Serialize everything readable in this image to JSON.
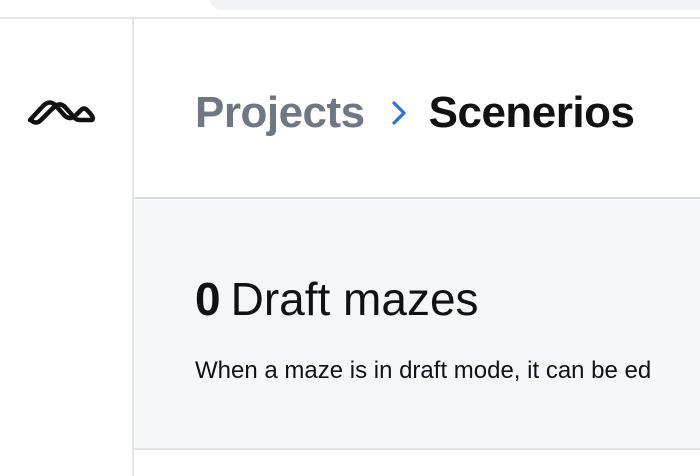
{
  "breadcrumb": {
    "parent": "Projects",
    "current": "Scenerios"
  },
  "drafts": {
    "count": "0",
    "label": "Draft mazes",
    "description": "When a maze is in draft mode, it can be ed"
  },
  "icons": {
    "logo": "maze-logo-icon",
    "separator": "chevron-right-icon"
  },
  "colors": {
    "accent": "#2f6fe4",
    "muted_text": "#6f7785",
    "text": "#111111",
    "panel_bg": "#f6f7f9",
    "border": "#e3e6ea"
  }
}
